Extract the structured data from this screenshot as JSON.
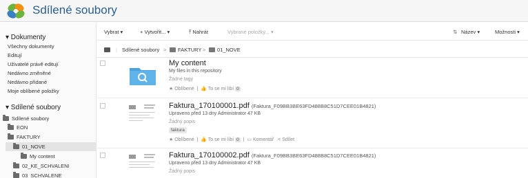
{
  "app": {
    "title": "Sdílené soubory",
    "colors": {
      "accent": "#2b5f8c",
      "logo_green": "#6cb33f",
      "logo_blue": "#3a7fc4",
      "logo_orange": "#f29111",
      "folder_blue": "#4aa3df"
    }
  },
  "sidebar": {
    "documents_header": "▾ Dokumenty",
    "documents_items": [
      "Všechny dokumenty",
      "Editují",
      "Uživatelé právě editují",
      "Nedávno změněné",
      "Nedávno přidané",
      "Moje oblíbené položky"
    ],
    "shared_header": "▾ Sdílené soubory",
    "tree": {
      "root": "Sdílené soubory",
      "eon": "EON",
      "faktury": "FAKTURY",
      "nove": "01_NOVE",
      "my_content": "My content",
      "ke_schvaleni": "02_KE_SCHVALENI",
      "schvalene": "03_SCHVALENE"
    }
  },
  "toolbar": {
    "select": "Vybrat ▾",
    "create": "+ Vytvořit... ▾",
    "upload": "⤒ Nahrát",
    "selected_items": "Vybrané položky... ▾",
    "sort_icon": "sort-icon",
    "sort_field": "Název ▾",
    "options": "Možnosti ▾"
  },
  "breadcrumb": {
    "root": "Sdílené soubory",
    "sep": ">",
    "level1": "FAKTURY",
    "level2": "01_NOVE"
  },
  "items": [
    {
      "type": "folder",
      "name": "My content",
      "description": "My files in this repository",
      "tags": "Žádné tagy",
      "favorite": "Oblíbené",
      "like": "To se mi líbí",
      "like_count": "0"
    },
    {
      "type": "pdf",
      "name": "Faktura_170100001.pdf",
      "subname": "(Faktura_F09BB3BE63FD488B8C51D7CEE01B4821)",
      "modified": "Upraveno před 13 dny Administrator    47 KB",
      "description": "Žádný popis",
      "tag": "faktura",
      "favorite": "Oblíbené",
      "like": "To se mi líbí",
      "like_count": "0",
      "comment": "Komentář",
      "share": "Sdílet"
    },
    {
      "type": "pdf",
      "name": "Faktura_170100002.pdf",
      "subname": "(Faktura_F09BB3BE63FD488B8C51D7CEE01B4821)",
      "modified": "Upraveno před 13 dny Administrator    47 KB",
      "description": "Žádný popis"
    }
  ]
}
